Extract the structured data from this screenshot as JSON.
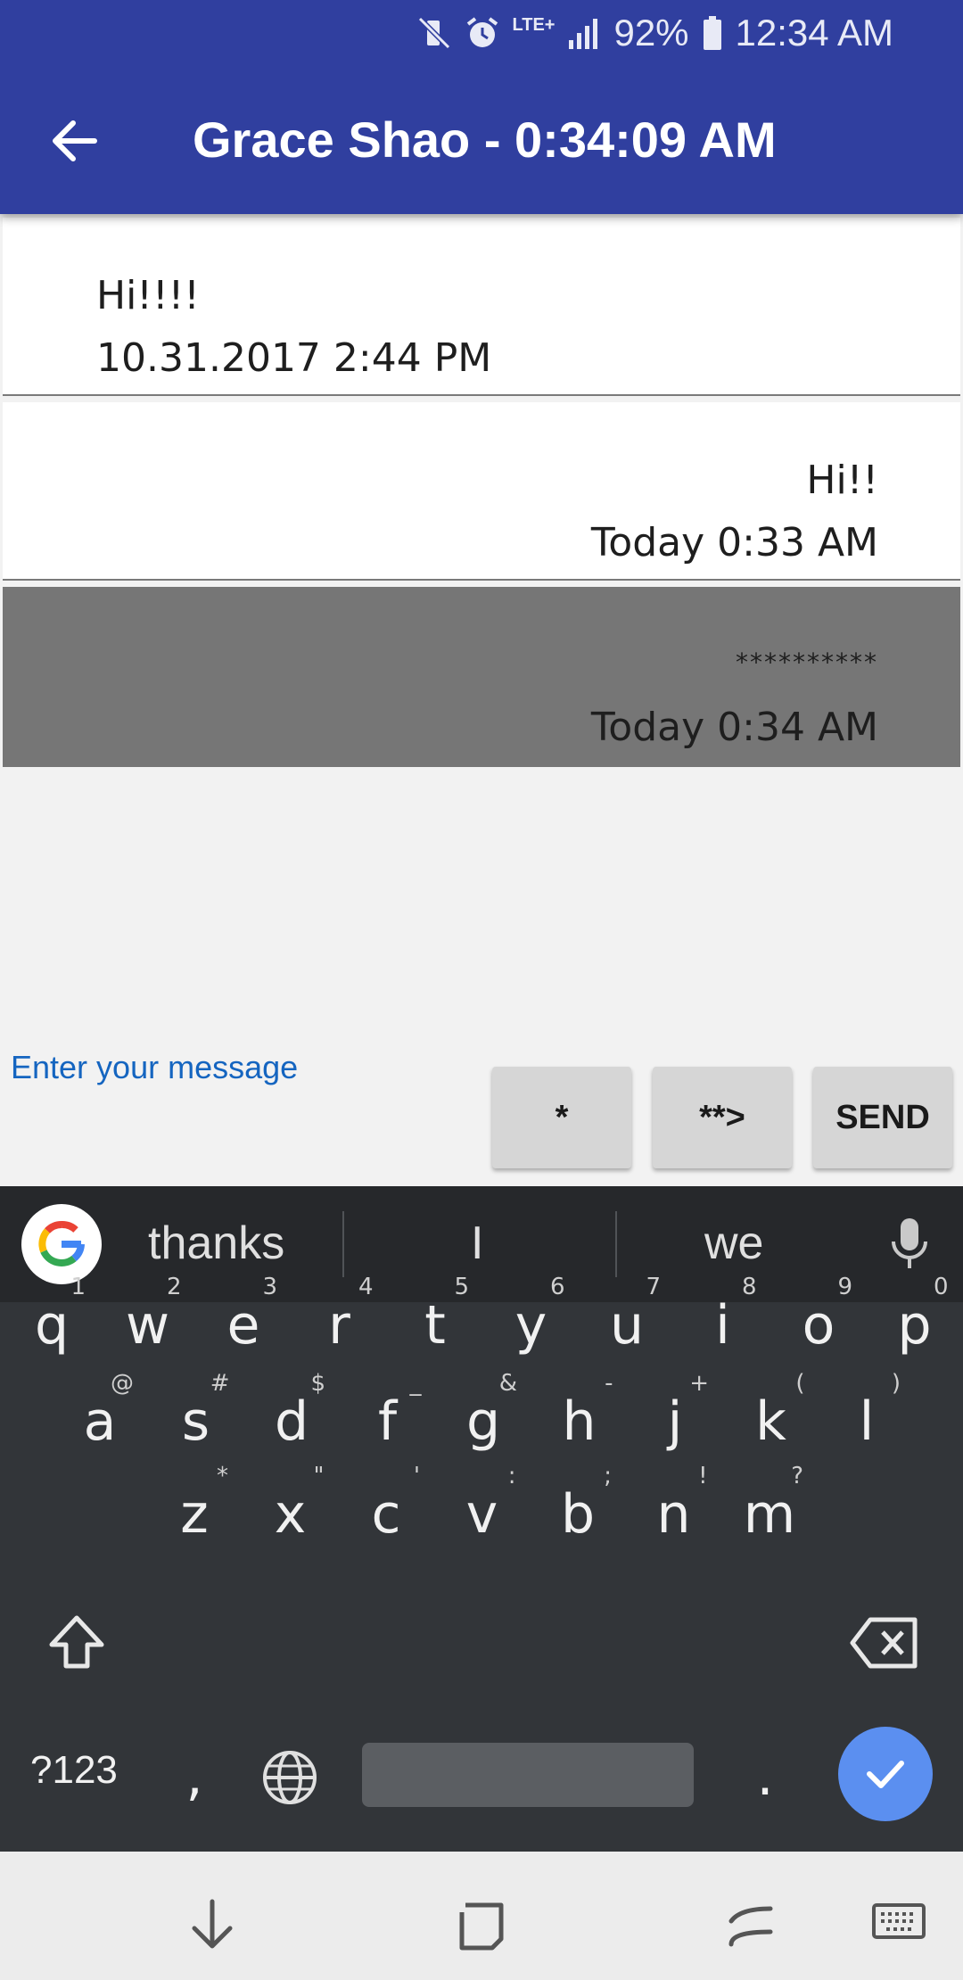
{
  "status_bar": {
    "network": "LTE+",
    "battery": "92%",
    "time": "12:34 AM",
    "icons": [
      "mute-vibrate-icon",
      "alarm-icon",
      "lte-icon",
      "signal-icon",
      "battery-icon"
    ]
  },
  "app_bar": {
    "title": "Grace Shao - 0:34:09 AM",
    "back_icon": "arrow-back-icon",
    "color": "#303f9f"
  },
  "messages": [
    {
      "text": "Hi!!!!",
      "time": "10.31.2017 2:44 PM",
      "align": "left",
      "bg": "#ffffff"
    },
    {
      "text": "Hi!!",
      "time": "Today 0:33 AM",
      "align": "right",
      "bg": "#ffffff"
    },
    {
      "text": "**********",
      "time": "Today 0:34 AM",
      "align": "right",
      "bg": "#767676"
    }
  ],
  "compose": {
    "placeholder": "Enter your message",
    "buttons": [
      "*",
      "**>",
      "SEND"
    ]
  },
  "keyboard": {
    "suggestions": [
      "thanks",
      "I",
      "we"
    ],
    "row1": [
      [
        "q",
        "1"
      ],
      [
        "w",
        "2"
      ],
      [
        "e",
        "3"
      ],
      [
        "r",
        "4"
      ],
      [
        "t",
        "5"
      ],
      [
        "y",
        "6"
      ],
      [
        "u",
        "7"
      ],
      [
        "i",
        "8"
      ],
      [
        "o",
        "9"
      ],
      [
        "p",
        "0"
      ]
    ],
    "row2": [
      [
        "a",
        "@"
      ],
      [
        "s",
        "#"
      ],
      [
        "d",
        "$"
      ],
      [
        "f",
        "_"
      ],
      [
        "g",
        "&"
      ],
      [
        "h",
        "-"
      ],
      [
        "j",
        "+"
      ],
      [
        "k",
        "("
      ],
      [
        "l",
        ")"
      ]
    ],
    "row3": [
      [
        "z",
        "*"
      ],
      [
        "x",
        "\""
      ],
      [
        "c",
        "'"
      ],
      [
        "v",
        ":"
      ],
      [
        "b",
        ";"
      ],
      [
        "n",
        "!"
      ],
      [
        "m",
        "?"
      ]
    ],
    "symbols_key": "?123",
    "comma": ",",
    "period": "."
  },
  "nav_bar": {
    "icons": [
      "hide-keyboard-icon",
      "recents-icon",
      "back-nav-icon",
      "keyboard-switch-icon"
    ]
  }
}
